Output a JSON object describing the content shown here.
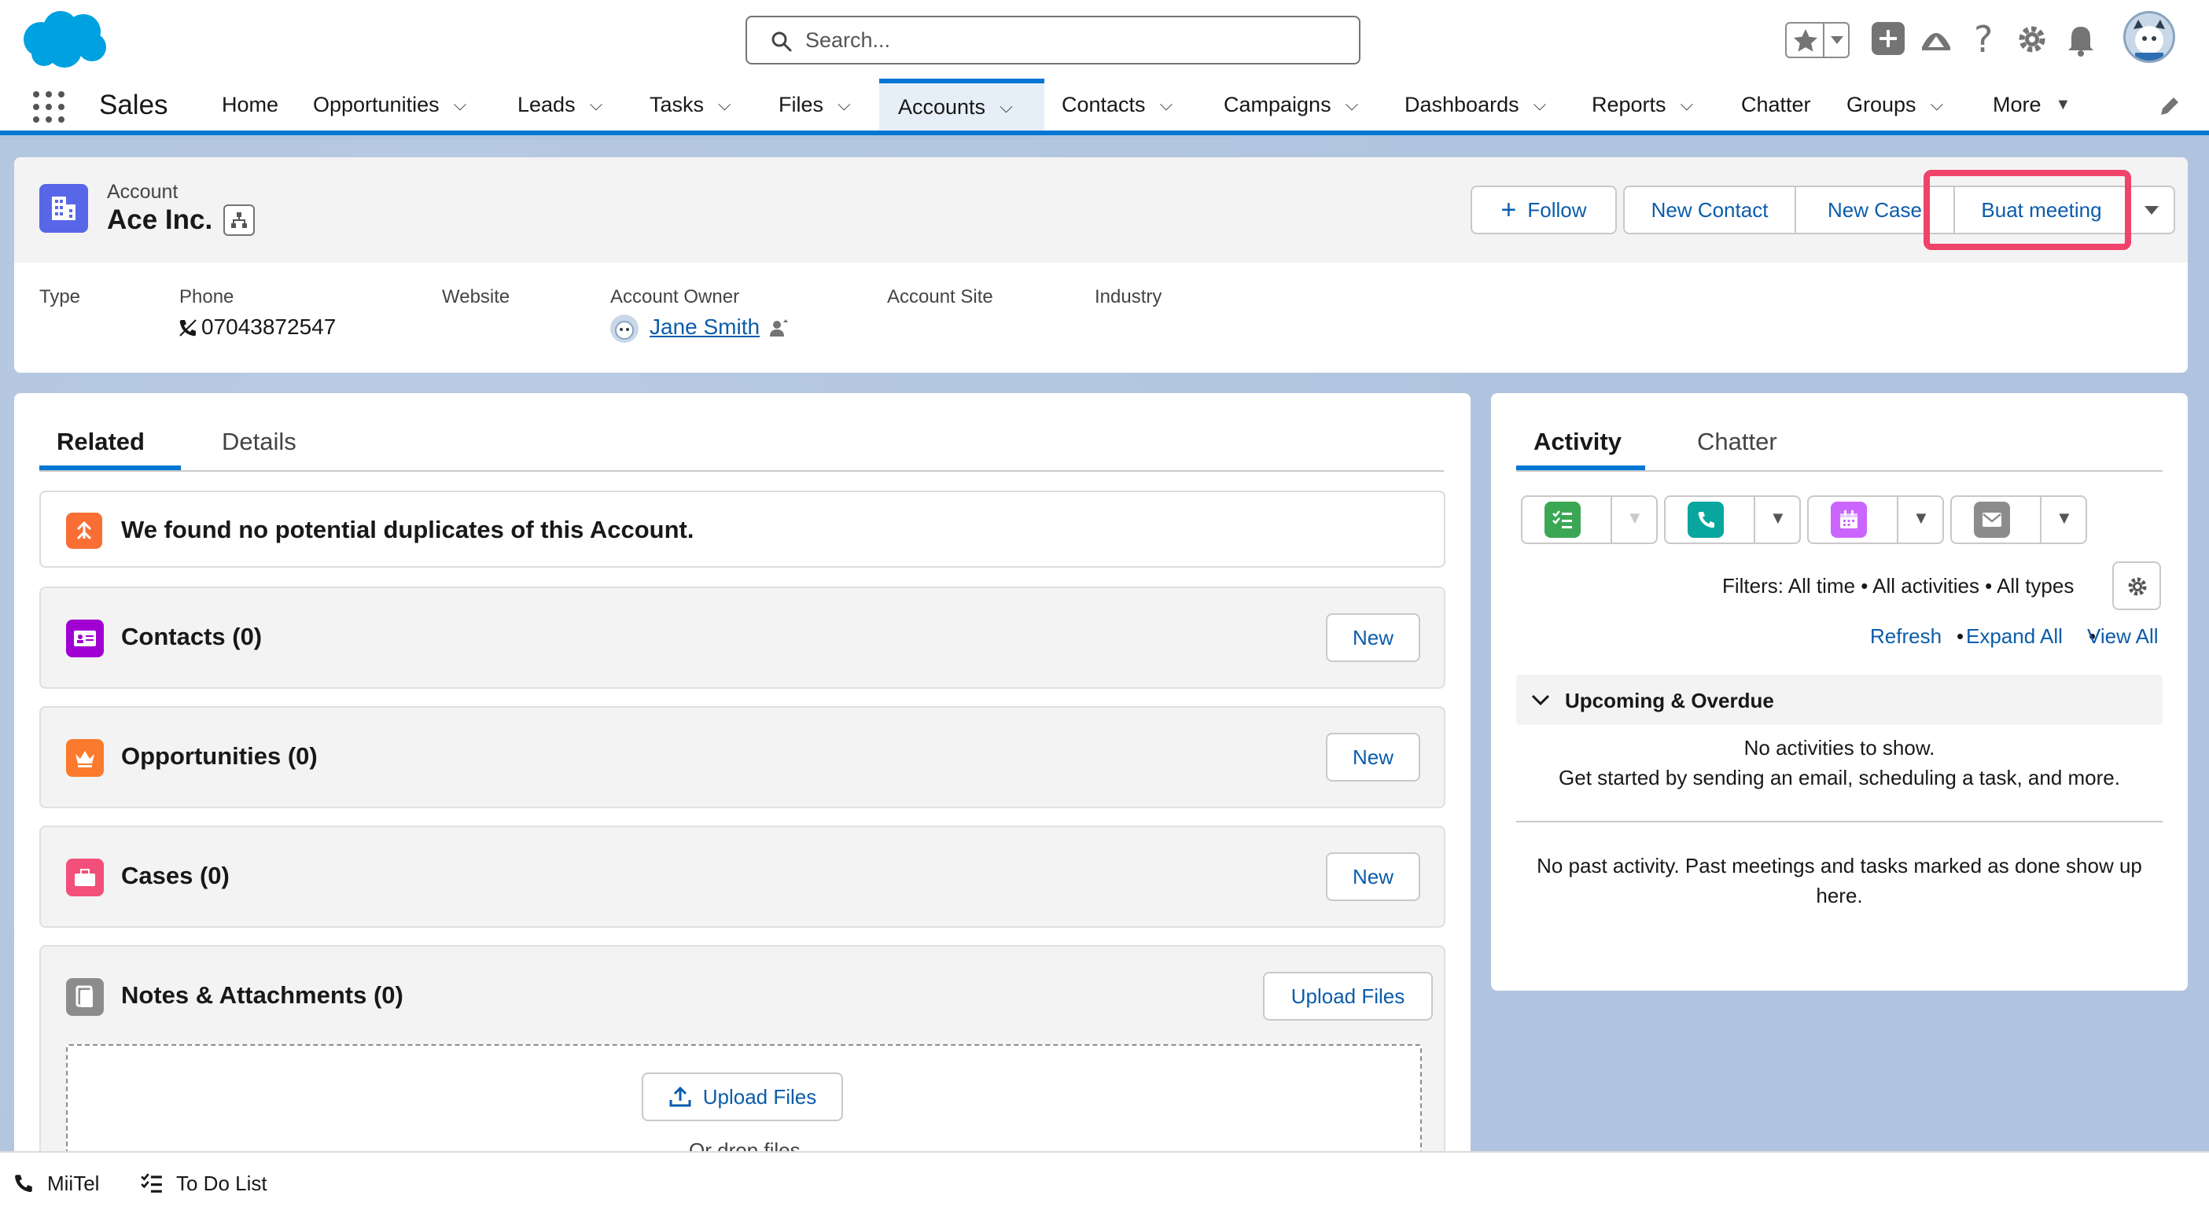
{
  "header": {
    "search_placeholder": "Search..."
  },
  "nav": {
    "app_name": "Sales",
    "items": [
      "Home",
      "Opportunities",
      "Leads",
      "Tasks",
      "Files",
      "Accounts",
      "Contacts",
      "Campaigns",
      "Dashboards",
      "Reports",
      "Chatter",
      "Groups",
      "More"
    ]
  },
  "record": {
    "object_label": "Account",
    "name": "Ace Inc.",
    "actions": {
      "follow": "Follow",
      "new_contact": "New Contact",
      "new_case": "New Case",
      "buat_meeting": "Buat meeting"
    },
    "fields": {
      "type_label": "Type",
      "phone_label": "Phone",
      "phone_value": "07043872547",
      "website_label": "Website",
      "owner_label": "Account Owner",
      "owner_value": "Jane Smith",
      "site_label": "Account Site",
      "industry_label": "Industry"
    }
  },
  "related": {
    "tabs": [
      "Related",
      "Details"
    ],
    "duplicates_msg": "We found no potential duplicates of this Account.",
    "contacts_title": "Contacts (0)",
    "opps_title": "Opportunities (0)",
    "cases_title": "Cases (0)",
    "notes_title": "Notes & Attachments (0)",
    "new_label": "New",
    "upload_files": "Upload Files",
    "upload_files_inner": "Upload Files",
    "drop_files": "Or drop files"
  },
  "activity": {
    "tabs": [
      "Activity",
      "Chatter"
    ],
    "filters": "Filters: All time • All activities • All types",
    "refresh": "Refresh",
    "expand_all": "Expand All",
    "view_all": "View All",
    "sep": "•",
    "upcoming": "Upcoming & Overdue",
    "no_activities": "No activities to show.",
    "get_started": "Get started by sending an email, scheduling a task, and more.",
    "no_past": "No past activity. Past meetings and tasks marked as done show up here."
  },
  "footer": {
    "miitel": "MiiTel",
    "todo": "To Do List"
  },
  "colors": {
    "brand": "#0176d3",
    "highlight": "#f0436a",
    "link": "#0b5cab"
  }
}
